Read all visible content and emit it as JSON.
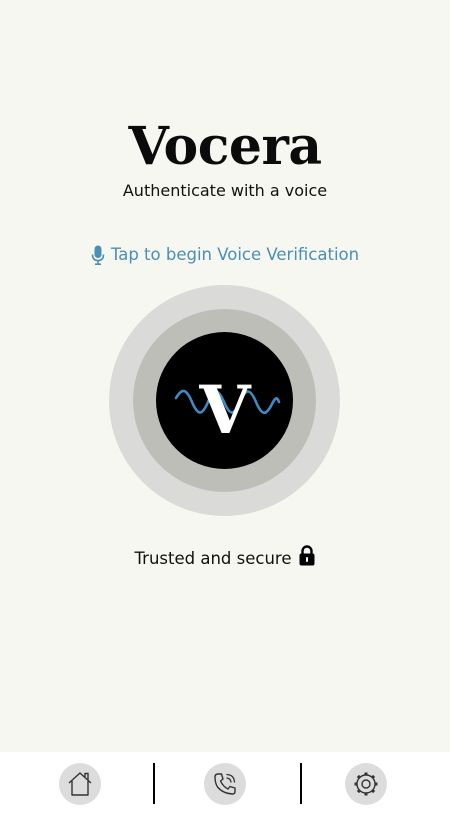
{
  "app": {
    "title": "Vocera",
    "subtitle": "Authenticate with a voice"
  },
  "voice": {
    "prompt": "Tap to begin Voice Verification",
    "prompt_icon": "microphone-icon",
    "logo_letter": "V"
  },
  "security": {
    "text": "Trusted and secure",
    "icon": "lock-icon"
  },
  "nav": {
    "items": [
      {
        "name": "home",
        "icon": "home-icon"
      },
      {
        "name": "calls",
        "icon": "phone-call-icon"
      },
      {
        "name": "settings",
        "icon": "gear-icon"
      }
    ]
  },
  "colors": {
    "background": "#f7f7f1",
    "accent": "#4a8fb5",
    "outer_ring": "#dadad8",
    "middle_ring": "#bebeb8",
    "inner_circle": "#000000",
    "wave": "#3f8cc4",
    "nav_background": "#ffffff",
    "nav_button": "#dcdcdc"
  }
}
